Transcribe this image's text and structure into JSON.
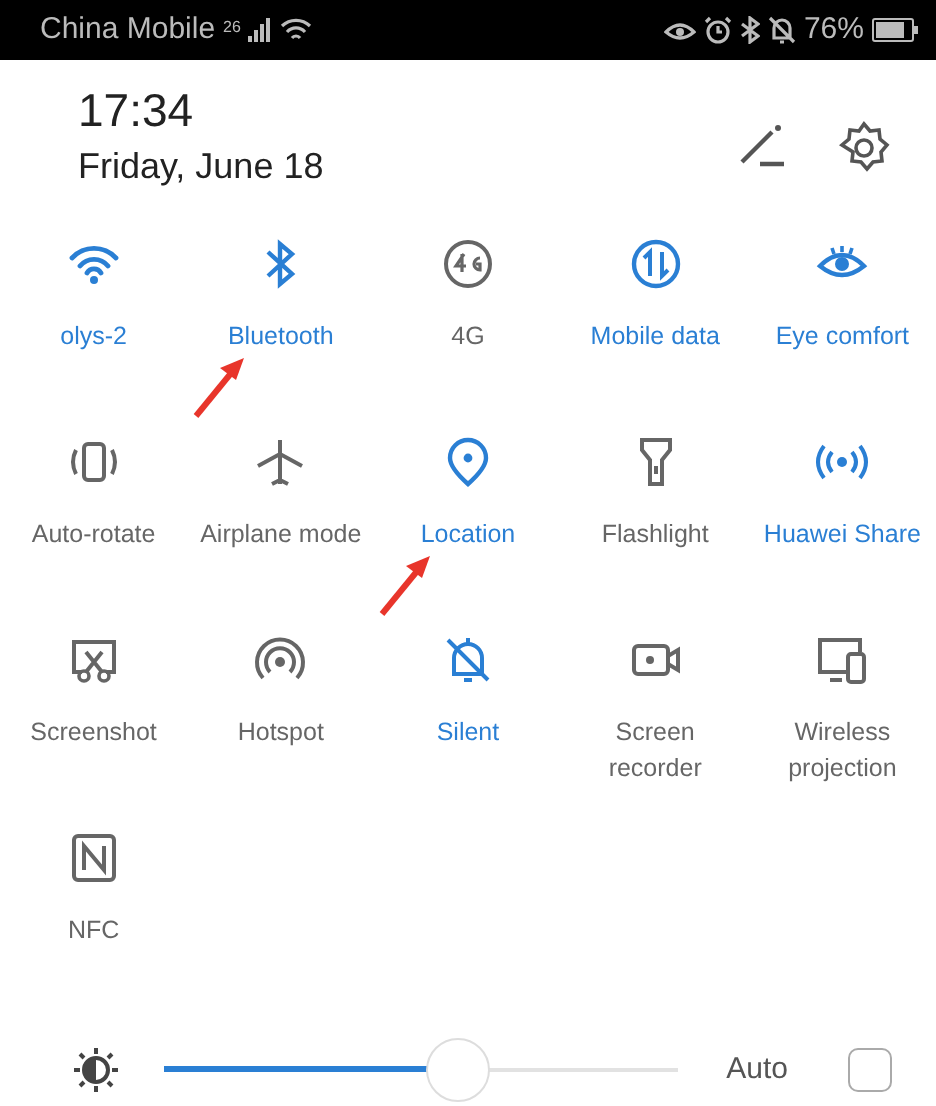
{
  "status_bar": {
    "carrier": "China Mobile",
    "network": "26",
    "battery": "76%"
  },
  "header": {
    "time": "17:34",
    "date": "Friday, June 18"
  },
  "tiles": [
    {
      "kind": "wifi",
      "label": "olys-2",
      "on": true,
      "marked": false
    },
    {
      "kind": "bluetooth",
      "label": "Bluetooth",
      "on": true,
      "marked": true
    },
    {
      "kind": "network",
      "label": "4G",
      "on": false,
      "marked": false
    },
    {
      "kind": "data",
      "label": "Mobile data",
      "on": true,
      "marked": false
    },
    {
      "kind": "eye",
      "label": "Eye comfort",
      "on": true,
      "marked": false
    },
    {
      "kind": "rotate",
      "label": "Auto-rotate",
      "on": false,
      "marked": false
    },
    {
      "kind": "airplane",
      "label": "Airplane mode",
      "on": false,
      "marked": false
    },
    {
      "kind": "location",
      "label": "Location",
      "on": true,
      "marked": true
    },
    {
      "kind": "flashlight",
      "label": "Flashlight",
      "on": false,
      "marked": false
    },
    {
      "kind": "share",
      "label": "Huawei Share",
      "on": true,
      "marked": false
    },
    {
      "kind": "screenshot",
      "label": "Screenshot",
      "on": false,
      "marked": false
    },
    {
      "kind": "hotspot",
      "label": "Hotspot",
      "on": false,
      "marked": false
    },
    {
      "kind": "silent",
      "label": "Silent",
      "on": true,
      "marked": false
    },
    {
      "kind": "recorder",
      "label": "Screen recorder",
      "on": false,
      "marked": false
    },
    {
      "kind": "projection",
      "label": "Wireless projection",
      "on": false,
      "marked": false
    },
    {
      "kind": "nfc",
      "label": "NFC",
      "on": false,
      "marked": false
    }
  ],
  "brightness": {
    "level": 0.57,
    "auto_label": "Auto",
    "auto_checked": false
  }
}
